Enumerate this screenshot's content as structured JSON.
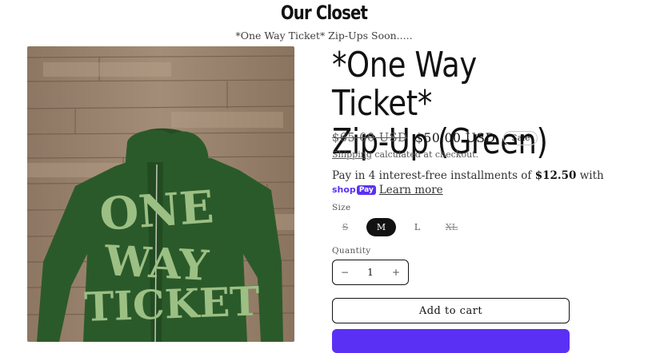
{
  "header": {
    "store_title": "Our Closet",
    "announcement": "*One Way Ticket* Zip-Ups Soon....."
  },
  "product": {
    "title_line1": "*One Way Ticket*",
    "title_line2": "Zip-Up (Green)",
    "price_original": "$65.00 USD",
    "price_sale": "$50.00 USD",
    "badge": "Sale",
    "shipping_link": "Shipping",
    "shipping_text": "calculated at checkout.",
    "installments_text": "Pay in 4 interest-free installments of",
    "installment_amount": "$12.50",
    "installments_suffix": "with",
    "shop_logo": "shop",
    "pay_logo": "Pay",
    "learn_more": "Learn more",
    "image_text": [
      "ONE",
      "WAY",
      "TICKET"
    ]
  },
  "options": {
    "size_label": "Size",
    "sizes": [
      {
        "label": "S",
        "state": "unavailable"
      },
      {
        "label": "M",
        "state": "selected"
      },
      {
        "label": "L",
        "state": "available"
      },
      {
        "label": "XL",
        "state": "unavailable"
      }
    ],
    "quantity_label": "Quantity",
    "quantity_value": "1",
    "decrement": "−",
    "increment": "+"
  },
  "actions": {
    "add_to_cart": "Add to cart"
  },
  "colors": {
    "hoodie_green": "#2b5a2a",
    "letter_green": "#9cbf84",
    "shop_pay_purple": "#5a31f4"
  }
}
